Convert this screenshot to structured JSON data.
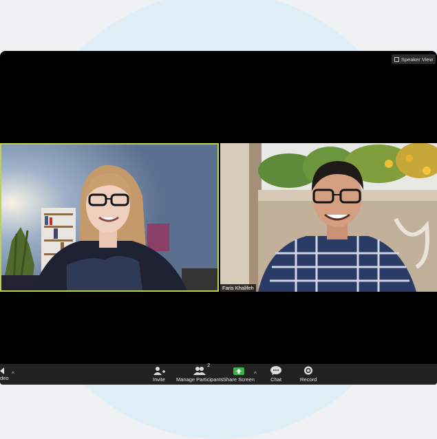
{
  "header": {
    "view_button": "Speaker View"
  },
  "participants": [
    {
      "name": ""
    },
    {
      "name": "Faris Khalifeh"
    }
  ],
  "toolbar": {
    "video_label": "deo",
    "invite_label": "Invite",
    "manage_participants_label": "Manage Participants",
    "participant_count": "2",
    "share_screen_label": "Share Screen",
    "chat_label": "Chat",
    "record_label": "Record"
  },
  "colors": {
    "active_speaker_border": "#b9d64a",
    "share_screen_green": "#3db34a",
    "toolbar_bg": "#222222"
  }
}
